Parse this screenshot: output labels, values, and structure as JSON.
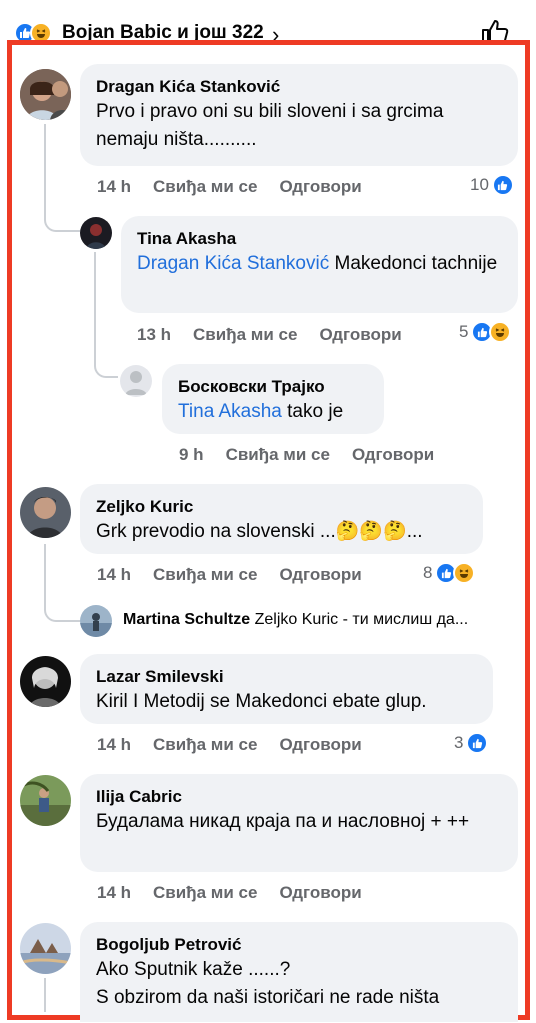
{
  "header": {
    "names": "Bojan Babic и још 322",
    "chevron": "›"
  },
  "icons": {
    "like": "like-icon",
    "haha": "haha-icon",
    "thumb": "thumbs-up-outline-icon"
  },
  "colors": {
    "highlight": "#ee3b24",
    "like_blue": "#1877f2",
    "mention": "#216fdb",
    "meta_gray": "#65676b"
  },
  "actions": {
    "like": "Свиђа ми се",
    "reply": "Одговори"
  },
  "comments": [
    {
      "author": "Dragan Kića Stanković",
      "text": "Prvo i pravo oni su bili  sloveni i sa grcima nemaju ništa..........",
      "time": "14 h",
      "count": "10"
    },
    {
      "author": "Tina Akasha",
      "mention": "Dragan Kića Stanković",
      "text": " Makedonci tachnije",
      "time": "13 h",
      "count": "5"
    },
    {
      "author": "Босковски Трајко",
      "mention": "Tina Akasha",
      "text": " tako je",
      "time": "9 h"
    },
    {
      "author": "Zeljko Kuric",
      "text": "Grk prevodio na slovenski ...🤔🤔🤔...",
      "time": "14 h",
      "count": "8"
    },
    {
      "author": "Martina Schultze",
      "text": "Zeljko Kuric - ти мислиш да..."
    },
    {
      "author": "Lazar Smilevski",
      "text": "Kiril I Metodij se Makedonci ebate glup.",
      "time": "14 h",
      "count": "3"
    },
    {
      "author": "Ilija Cabric",
      "text": "Будалама никад краја па и насловној + ++",
      "time": "14 h"
    },
    {
      "author": "Bogoljub Petrović",
      "text_line1": "Ako Sputnik kaže ......?",
      "text_line2": "S obzirom da naši istoričari ne rade ništa"
    }
  ]
}
